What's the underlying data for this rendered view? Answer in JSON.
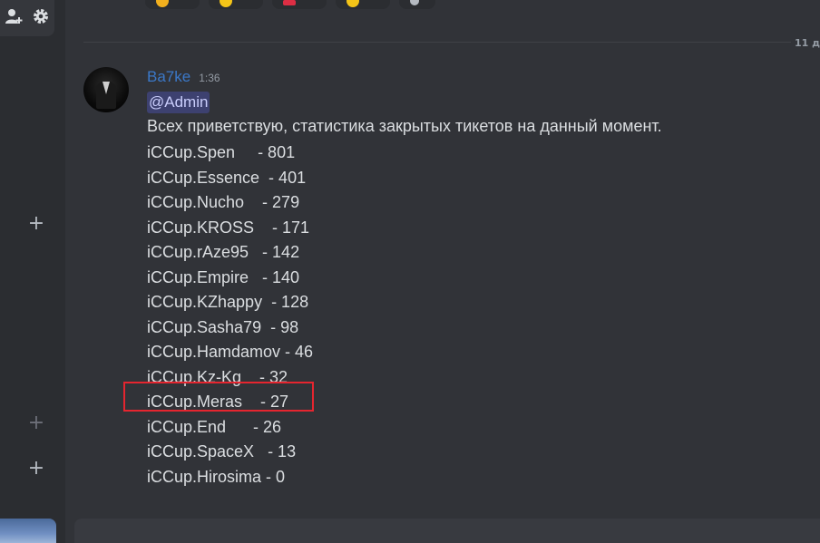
{
  "sidebar": {
    "top_icons": [
      "add-friend-icon",
      "gear-icon"
    ],
    "plus_label": "+"
  },
  "divider": {
    "date": "11 д"
  },
  "message": {
    "author": "Ba7ke",
    "author_color": "#3b78c8",
    "time": "1:36",
    "mention": "@Admin",
    "greeting": "Всех приветствую, статистика закрытых тикетов на данный момент.",
    "stats": [
      {
        "text": "iCCup.Spen     - 801"
      },
      {
        "text": "iCCup.Essence  - 401"
      },
      {
        "text": "iCCup.Nucho    - 279"
      },
      {
        "text": "iCCup.KROSS    - 171"
      },
      {
        "text": "iCCup.rAze95   - 142"
      },
      {
        "text": "iCCup.Empire   - 140"
      },
      {
        "text": "iCCup.KZhappy  - 128"
      },
      {
        "text": "iCCup.Sasha79  - 98"
      },
      {
        "text": "iCCup.Hamdamov - 46"
      },
      {
        "text": "iCCup.Kz-Kg    - 32"
      },
      {
        "text": "iCCup.Meras    - 27"
      },
      {
        "text": "iCCup.End      - 26"
      },
      {
        "text": "iCCup.SpaceX   - 13"
      },
      {
        "text": "iCCup.Hirosima - 0"
      }
    ],
    "highlighted_row": "iCCup.Meras"
  },
  "colors": {
    "background": "#313338",
    "sidebar": "#2b2d31",
    "highlight": "#e5252f"
  }
}
